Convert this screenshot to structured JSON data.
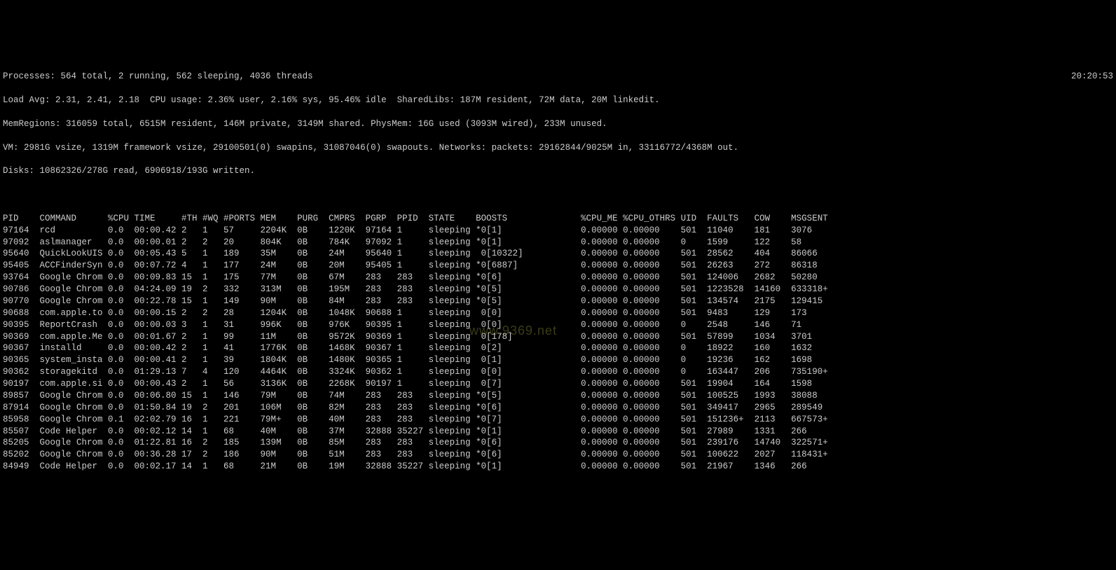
{
  "clock": "20:20:53",
  "summary": {
    "processes": "Processes: 564 total, 2 running, 562 sleeping, 4036 threads",
    "load": "Load Avg: 2.31, 2.41, 2.18  CPU usage: 2.36% user, 2.16% sys, 95.46% idle  SharedLibs: 187M resident, 72M data, 20M linkedit.",
    "memreg": "MemRegions: 316059 total, 6515M resident, 146M private, 3149M shared. PhysMem: 16G used (3093M wired), 233M unused.",
    "vm": "VM: 2981G vsize, 1319M framework vsize, 29100501(0) swapins, 31087046(0) swapouts. Networks: packets: 29162844/9025M in, 33116772/4368M out.",
    "disks": "Disks: 10862326/278G read, 6906918/193G written."
  },
  "columns": [
    "PID",
    "COMMAND",
    "%CPU",
    "TIME",
    "#TH",
    "#WQ",
    "#PORTS",
    "MEM",
    "PURG",
    "CMPRS",
    "PGRP",
    "PPID",
    "STATE",
    "BOOSTS",
    "%CPU_ME",
    "%CPU_OTHRS",
    "UID",
    "FAULTS",
    "COW",
    "MSGSENT"
  ],
  "rows": [
    {
      "pid": "97164",
      "cmd": "rcd",
      "cpu": "0.0",
      "time": "00:00.42",
      "th": "2",
      "wq": "1",
      "ports": "57",
      "mem": "2204K",
      "purg": "0B",
      "cmprs": "1220K",
      "pgrp": "97164",
      "ppid": "1",
      "state": "sleeping",
      "boosts": "*0[1]",
      "me": "0.00000",
      "oth": "0.00000",
      "uid": "501",
      "faults": "11040",
      "cow": "181",
      "msg": "3076"
    },
    {
      "pid": "97092",
      "cmd": "aslmanager",
      "cpu": "0.0",
      "time": "00:00.01",
      "th": "2",
      "wq": "2",
      "ports": "20",
      "mem": "804K",
      "purg": "0B",
      "cmprs": "784K",
      "pgrp": "97092",
      "ppid": "1",
      "state": "sleeping",
      "boosts": "*0[1]",
      "me": "0.00000",
      "oth": "0.00000",
      "uid": "0",
      "faults": "1599",
      "cow": "122",
      "msg": "58"
    },
    {
      "pid": "95640",
      "cmd": "QuickLookUIS",
      "cpu": "0.0",
      "time": "00:05.43",
      "th": "5",
      "wq": "1",
      "ports": "189",
      "mem": "35M",
      "purg": "0B",
      "cmprs": "24M",
      "pgrp": "95640",
      "ppid": "1",
      "state": "sleeping",
      "boosts": " 0[10322]",
      "me": "0.00000",
      "oth": "0.00000",
      "uid": "501",
      "faults": "28562",
      "cow": "404",
      "msg": "86066"
    },
    {
      "pid": "95405",
      "cmd": "ACCFinderSyn",
      "cpu": "0.0",
      "time": "00:07.72",
      "th": "4",
      "wq": "1",
      "ports": "177",
      "mem": "24M",
      "purg": "0B",
      "cmprs": "20M",
      "pgrp": "95405",
      "ppid": "1",
      "state": "sleeping",
      "boosts": "*0[6887]",
      "me": "0.00000",
      "oth": "0.00000",
      "uid": "501",
      "faults": "26263",
      "cow": "272",
      "msg": "86318"
    },
    {
      "pid": "93764",
      "cmd": "Google Chrom",
      "cpu": "0.0",
      "time": "00:09.83",
      "th": "15",
      "wq": "1",
      "ports": "175",
      "mem": "77M",
      "purg": "0B",
      "cmprs": "67M",
      "pgrp": "283",
      "ppid": "283",
      "state": "sleeping",
      "boosts": "*0[6]",
      "me": "0.00000",
      "oth": "0.00000",
      "uid": "501",
      "faults": "124006",
      "cow": "2682",
      "msg": "50280"
    },
    {
      "pid": "90786",
      "cmd": "Google Chrom",
      "cpu": "0.0",
      "time": "04:24.09",
      "th": "19",
      "wq": "2",
      "ports": "332",
      "mem": "313M",
      "purg": "0B",
      "cmprs": "195M",
      "pgrp": "283",
      "ppid": "283",
      "state": "sleeping",
      "boosts": "*0[5]",
      "me": "0.00000",
      "oth": "0.00000",
      "uid": "501",
      "faults": "1223528",
      "cow": "14160",
      "msg": "633318+"
    },
    {
      "pid": "90770",
      "cmd": "Google Chrom",
      "cpu": "0.0",
      "time": "00:22.78",
      "th": "15",
      "wq": "1",
      "ports": "149",
      "mem": "90M",
      "purg": "0B",
      "cmprs": "84M",
      "pgrp": "283",
      "ppid": "283",
      "state": "sleeping",
      "boosts": "*0[5]",
      "me": "0.00000",
      "oth": "0.00000",
      "uid": "501",
      "faults": "134574",
      "cow": "2175",
      "msg": "129415"
    },
    {
      "pid": "90688",
      "cmd": "com.apple.to",
      "cpu": "0.0",
      "time": "00:00.15",
      "th": "2",
      "wq": "2",
      "ports": "28",
      "mem": "1204K",
      "purg": "0B",
      "cmprs": "1048K",
      "pgrp": "90688",
      "ppid": "1",
      "state": "sleeping",
      "boosts": " 0[0]",
      "me": "0.00000",
      "oth": "0.00000",
      "uid": "501",
      "faults": "9483",
      "cow": "129",
      "msg": "173"
    },
    {
      "pid": "90395",
      "cmd": "ReportCrash",
      "cpu": "0.0",
      "time": "00:00.03",
      "th": "3",
      "wq": "1",
      "ports": "31",
      "mem": "996K",
      "purg": "0B",
      "cmprs": "976K",
      "pgrp": "90395",
      "ppid": "1",
      "state": "sleeping",
      "boosts": " 0[0]",
      "me": "0.00000",
      "oth": "0.00000",
      "uid": "0",
      "faults": "2548",
      "cow": "146",
      "msg": "71"
    },
    {
      "pid": "90369",
      "cmd": "com.apple.Me",
      "cpu": "0.0",
      "time": "00:01.67",
      "th": "2",
      "wq": "1",
      "ports": "99",
      "mem": "11M",
      "purg": "0B",
      "cmprs": "9572K",
      "pgrp": "90369",
      "ppid": "1",
      "state": "sleeping",
      "boosts": " 0[178]",
      "me": "0.00000",
      "oth": "0.00000",
      "uid": "501",
      "faults": "57899",
      "cow": "1034",
      "msg": "3701"
    },
    {
      "pid": "90367",
      "cmd": "installd",
      "cpu": "0.0",
      "time": "00:00.42",
      "th": "2",
      "wq": "1",
      "ports": "41",
      "mem": "1776K",
      "purg": "0B",
      "cmprs": "1468K",
      "pgrp": "90367",
      "ppid": "1",
      "state": "sleeping",
      "boosts": " 0[2]",
      "me": "0.00000",
      "oth": "0.00000",
      "uid": "0",
      "faults": "18922",
      "cow": "160",
      "msg": "1632"
    },
    {
      "pid": "90365",
      "cmd": "system_insta",
      "cpu": "0.0",
      "time": "00:00.41",
      "th": "2",
      "wq": "1",
      "ports": "39",
      "mem": "1804K",
      "purg": "0B",
      "cmprs": "1480K",
      "pgrp": "90365",
      "ppid": "1",
      "state": "sleeping",
      "boosts": " 0[1]",
      "me": "0.00000",
      "oth": "0.00000",
      "uid": "0",
      "faults": "19236",
      "cow": "162",
      "msg": "1698"
    },
    {
      "pid": "90362",
      "cmd": "storagekitd",
      "cpu": "0.0",
      "time": "01:29.13",
      "th": "7",
      "wq": "4",
      "ports": "120",
      "mem": "4464K",
      "purg": "0B",
      "cmprs": "3324K",
      "pgrp": "90362",
      "ppid": "1",
      "state": "sleeping",
      "boosts": " 0[0]",
      "me": "0.00000",
      "oth": "0.00000",
      "uid": "0",
      "faults": "163447",
      "cow": "206",
      "msg": "735190+"
    },
    {
      "pid": "90197",
      "cmd": "com.apple.si",
      "cpu": "0.0",
      "time": "00:00.43",
      "th": "2",
      "wq": "1",
      "ports": "56",
      "mem": "3136K",
      "purg": "0B",
      "cmprs": "2268K",
      "pgrp": "90197",
      "ppid": "1",
      "state": "sleeping",
      "boosts": " 0[7]",
      "me": "0.00000",
      "oth": "0.00000",
      "uid": "501",
      "faults": "19904",
      "cow": "164",
      "msg": "1598"
    },
    {
      "pid": "89857",
      "cmd": "Google Chrom",
      "cpu": "0.0",
      "time": "00:06.80",
      "th": "15",
      "wq": "1",
      "ports": "146",
      "mem": "79M",
      "purg": "0B",
      "cmprs": "74M",
      "pgrp": "283",
      "ppid": "283",
      "state": "sleeping",
      "boosts": "*0[5]",
      "me": "0.00000",
      "oth": "0.00000",
      "uid": "501",
      "faults": "100525",
      "cow": "1993",
      "msg": "38088"
    },
    {
      "pid": "87914",
      "cmd": "Google Chrom",
      "cpu": "0.0",
      "time": "01:50.84",
      "th": "19",
      "wq": "2",
      "ports": "201",
      "mem": "106M",
      "purg": "0B",
      "cmprs": "82M",
      "pgrp": "283",
      "ppid": "283",
      "state": "sleeping",
      "boosts": "*0[6]",
      "me": "0.00000",
      "oth": "0.00000",
      "uid": "501",
      "faults": "349417",
      "cow": "2965",
      "msg": "289549"
    },
    {
      "pid": "85958",
      "cmd": "Google Chrom",
      "cpu": "0.1",
      "time": "02:02.79",
      "th": "16",
      "wq": "1",
      "ports": "221",
      "mem": "79M+",
      "purg": "0B",
      "cmprs": "40M",
      "pgrp": "283",
      "ppid": "283",
      "state": "sleeping",
      "boosts": "*0[7]",
      "me": "0.00000",
      "oth": "0.00000",
      "uid": "501",
      "faults": "151236+",
      "cow": "2113",
      "msg": "667573+"
    },
    {
      "pid": "85507",
      "cmd": "Code Helper",
      "cpu": "0.0",
      "time": "00:02.12",
      "th": "14",
      "wq": "1",
      "ports": "68",
      "mem": "40M",
      "purg": "0B",
      "cmprs": "37M",
      "pgrp": "32888",
      "ppid": "35227",
      "state": "sleeping",
      "boosts": "*0[1]",
      "me": "0.00000",
      "oth": "0.00000",
      "uid": "501",
      "faults": "27989",
      "cow": "1331",
      "msg": "266"
    },
    {
      "pid": "85205",
      "cmd": "Google Chrom",
      "cpu": "0.0",
      "time": "01:22.81",
      "th": "16",
      "wq": "2",
      "ports": "185",
      "mem": "139M",
      "purg": "0B",
      "cmprs": "85M",
      "pgrp": "283",
      "ppid": "283",
      "state": "sleeping",
      "boosts": "*0[6]",
      "me": "0.00000",
      "oth": "0.00000",
      "uid": "501",
      "faults": "239176",
      "cow": "14740",
      "msg": "322571+"
    },
    {
      "pid": "85202",
      "cmd": "Google Chrom",
      "cpu": "0.0",
      "time": "00:36.28",
      "th": "17",
      "wq": "2",
      "ports": "186",
      "mem": "90M",
      "purg": "0B",
      "cmprs": "51M",
      "pgrp": "283",
      "ppid": "283",
      "state": "sleeping",
      "boosts": "*0[6]",
      "me": "0.00000",
      "oth": "0.00000",
      "uid": "501",
      "faults": "100622",
      "cow": "2027",
      "msg": "118431+"
    },
    {
      "pid": "84949",
      "cmd": "Code Helper",
      "cpu": "0.0",
      "time": "00:02.17",
      "th": "14",
      "wq": "1",
      "ports": "68",
      "mem": "21M",
      "purg": "0B",
      "cmprs": "19M",
      "pgrp": "32888",
      "ppid": "35227",
      "state": "sleeping",
      "boosts": "*0[1]",
      "me": "0.00000",
      "oth": "0.00000",
      "uid": "501",
      "faults": "21967",
      "cow": "1346",
      "msg": "266"
    }
  ],
  "watermark": "www.9369.net",
  "col_widths": {
    "pid": 7,
    "cmd": 13,
    "cpu": 5,
    "time": 9,
    "th": 4,
    "wq": 4,
    "ports": 7,
    "mem": 7,
    "purg": 6,
    "cmprs": 7,
    "pgrp": 6,
    "ppid": 6,
    "state": 9,
    "boosts": 20,
    "me": 8,
    "oth": 11,
    "uid": 5,
    "faults": 9,
    "cow": 7,
    "msg": 8
  }
}
